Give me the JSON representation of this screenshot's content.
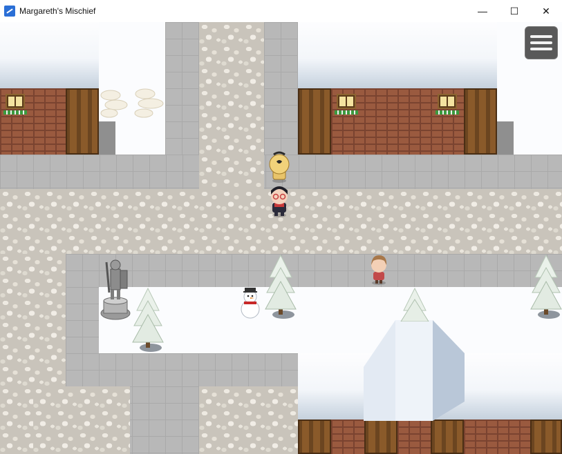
{
  "window": {
    "title": "Margareth's Mischief",
    "icon": "rpg-maker-icon",
    "controls": {
      "minimize": "—",
      "maximize": "☐",
      "close": "✕"
    }
  },
  "game": {
    "menu_icon": "hamburger-menu-icon"
  }
}
